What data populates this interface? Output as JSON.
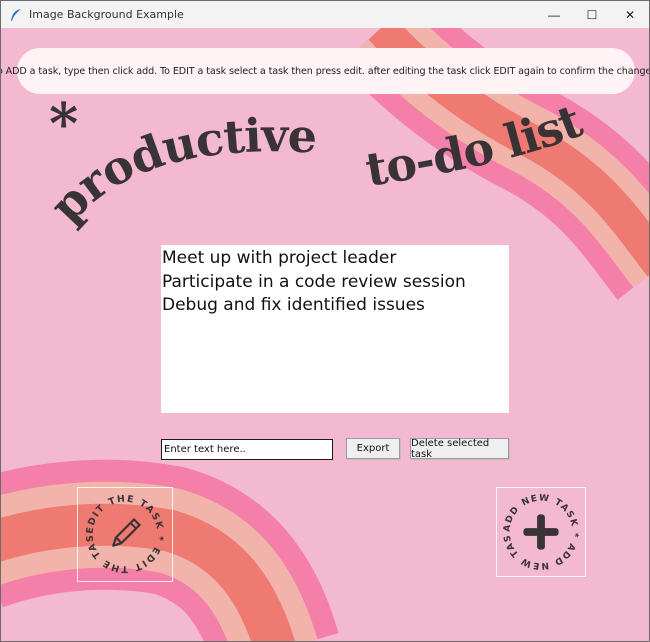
{
  "window": {
    "title": "Image Background Example",
    "controls": {
      "minimize": "—",
      "maximize": "☐",
      "close": "✕"
    }
  },
  "instruction": "To ADD a task, type then click add. To EDIT a task select a task then press edit. after editing the task click EDIT again to confirm the changes.",
  "headline": {
    "word1": "productive",
    "word2": "to-do list",
    "asterisk": "*"
  },
  "tasks": [
    "Meet up with project leader",
    "Participate in a code review session",
    "Debug and fix identified issues"
  ],
  "entry": {
    "placeholder": "Enter text here..",
    "value": "Enter text here.."
  },
  "buttons": {
    "export": "Export",
    "delete": "Delete selected task"
  },
  "edit_badge": {
    "ring_text": "EDIT THE TASK * EDIT THE TASK *",
    "icon": "pencil-icon"
  },
  "add_badge": {
    "ring_text": "ADD NEW TASK * ADD NEW TASK *",
    "icon": "plus-icon"
  },
  "colors": {
    "background": "#f3b9d0",
    "stripe_pink": "#f47fa8",
    "stripe_peach": "#f2b4aa",
    "stripe_coral": "#ee7a72",
    "headline": "#3a3335"
  }
}
